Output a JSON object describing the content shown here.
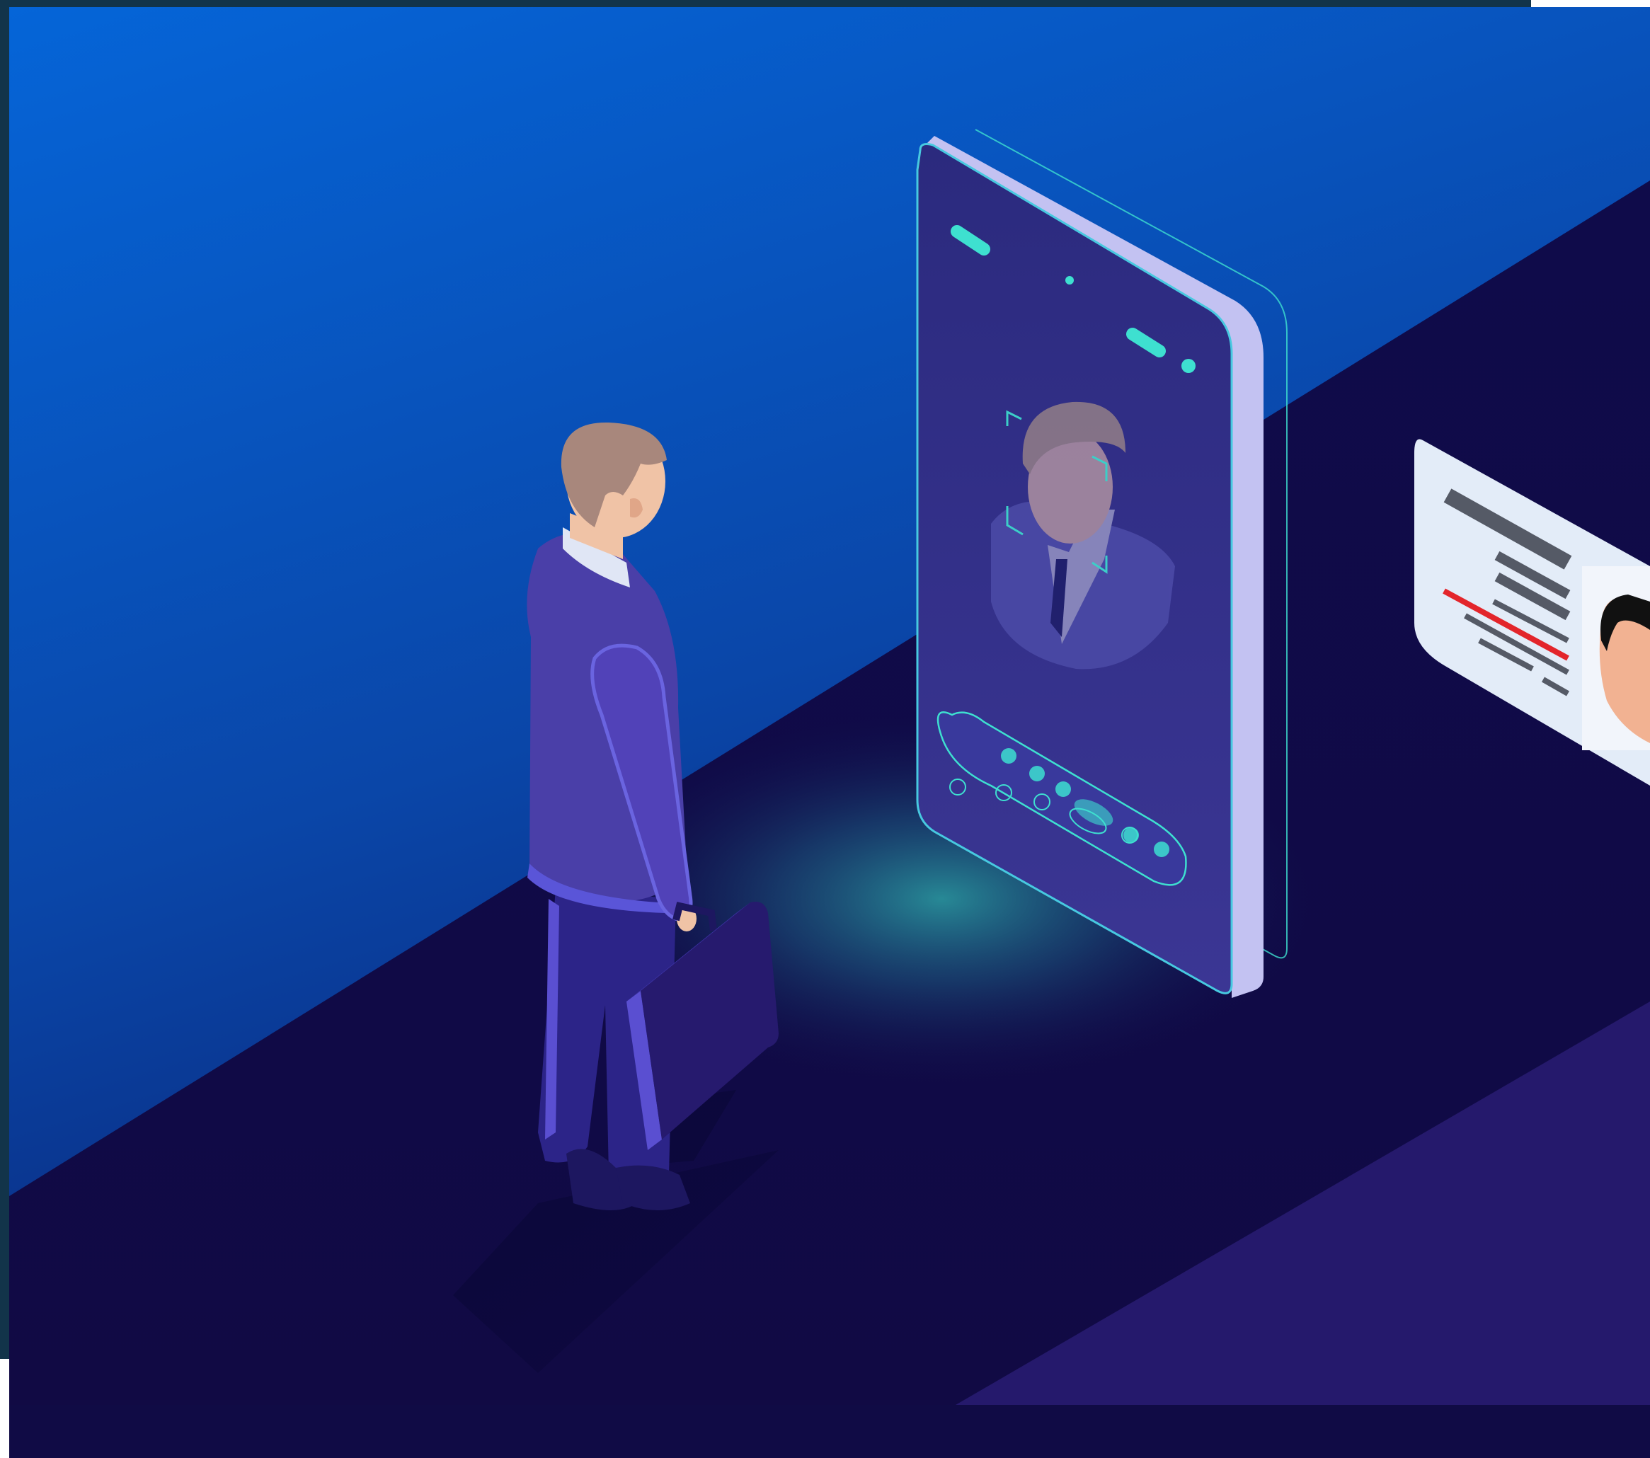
{
  "scene": {
    "colors": {
      "frame": "#12344a",
      "sky_top": "#0565d8",
      "sky_bottom": "#0b1f6e",
      "floor": "#0d0a45",
      "floor_near": "#130d52",
      "purple_panel": "#25196c",
      "bottom_band": "#100b45",
      "phone_glow": "#3ee0d0",
      "suit": "#4a3fa8",
      "id_card": "#e3ecf8",
      "id_red_line": "#e3252b"
    },
    "objects": [
      {
        "name": "businessman",
        "icon": "person-with-briefcase"
      },
      {
        "name": "smartphone",
        "icon": "face-scan-screen"
      },
      {
        "name": "id-card",
        "icon": "identity-card"
      }
    ]
  }
}
